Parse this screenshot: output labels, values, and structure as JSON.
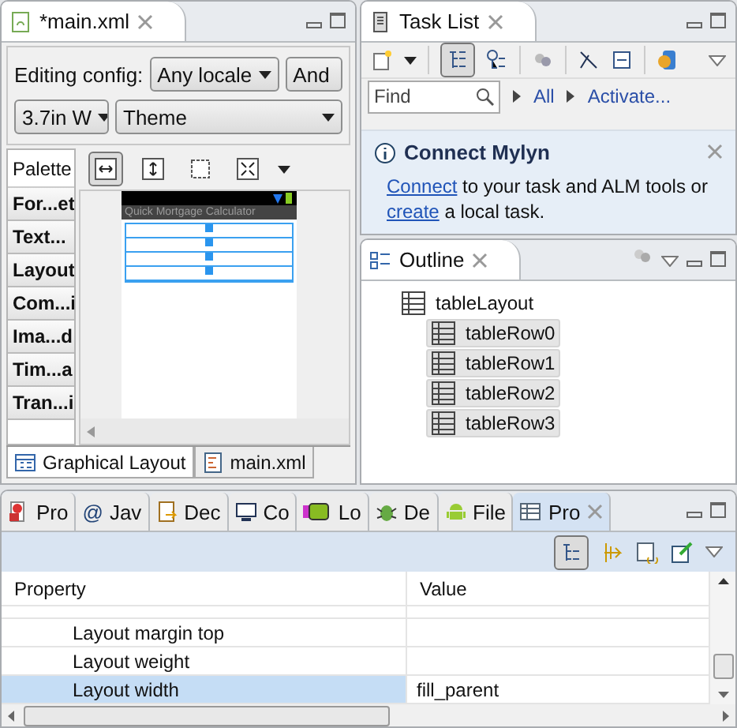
{
  "editor": {
    "tab": {
      "title": "*main.xml"
    },
    "config": {
      "label": "Editing config:",
      "locale": "Any locale",
      "target": "And",
      "device": "3.7in W",
      "theme": "Theme"
    },
    "palette": {
      "title": "Palette",
      "items": [
        "For...et",
        "Text...",
        "Layout",
        "Com...i",
        "Ima...d",
        "Tim...a",
        "Tran...i"
      ]
    },
    "canvas": {
      "app_title": "Quick Mortgage Calculator"
    },
    "subtabs": [
      {
        "label": "Graphical Layout",
        "kind": "layout",
        "selected": true
      },
      {
        "label": "main.xml",
        "kind": "xml",
        "selected": false
      }
    ]
  },
  "task_list": {
    "title": "Task List",
    "find": {
      "placeholder": "Find"
    },
    "filters": [
      "All",
      "Activate..."
    ],
    "connect": {
      "title": "Connect Mylyn",
      "parts": [
        {
          "kind": "link",
          "text": "Connect"
        },
        {
          "kind": "plain",
          "text": " to your task and ALM tools or "
        },
        {
          "kind": "link",
          "text": "create"
        },
        {
          "kind": "plain",
          "text": " a local task."
        }
      ]
    }
  },
  "outline": {
    "title": "Outline",
    "tree": [
      {
        "label": "tableLayout",
        "selected": false,
        "children": [
          {
            "label": "tableRow0",
            "selected": true
          },
          {
            "label": "tableRow1",
            "selected": true
          },
          {
            "label": "tableRow2",
            "selected": true
          },
          {
            "label": "tableRow3",
            "selected": true
          }
        ]
      }
    ]
  },
  "bottom_tabs": [
    {
      "label": "Pro",
      "kind": "problems",
      "selected": false
    },
    {
      "label": "Jav",
      "kind": "javadoc",
      "glyph": "@",
      "selected": false
    },
    {
      "label": "Dec",
      "kind": "declaration",
      "selected": false
    },
    {
      "label": "Co",
      "kind": "console",
      "selected": false
    },
    {
      "label": "Lo",
      "kind": "logcat",
      "selected": false
    },
    {
      "label": "De",
      "kind": "debug",
      "selected": false
    },
    {
      "label": "File",
      "kind": "android",
      "selected": false
    },
    {
      "label": "Pro",
      "kind": "properties",
      "selected": true
    }
  ],
  "properties": {
    "columns": [
      "Property",
      "Value"
    ],
    "rows": [
      {
        "property": "Layout margin top",
        "selected": false
      },
      {
        "property": "Layout weight",
        "selected": false
      },
      {
        "property": "Layout width",
        "value": "fill_parent",
        "selected": true
      }
    ]
  }
}
